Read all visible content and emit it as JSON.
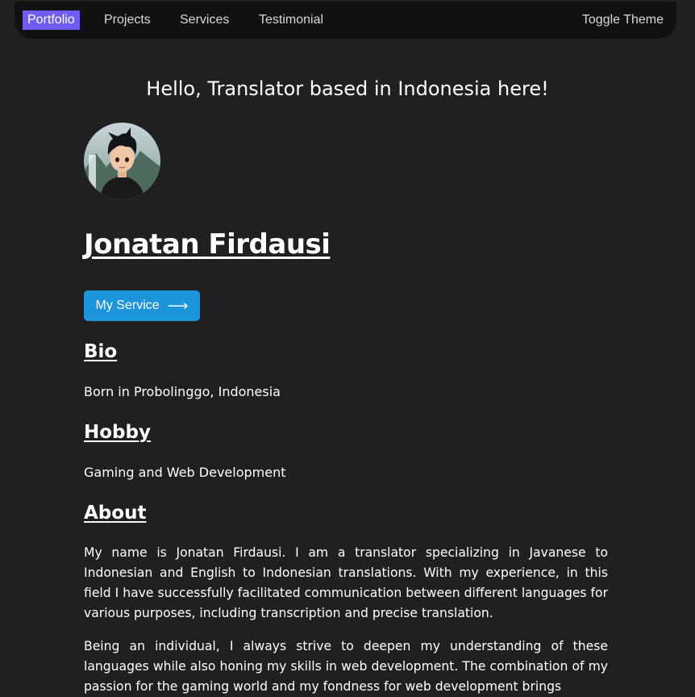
{
  "nav": {
    "items": [
      {
        "label": "Portfolio"
      },
      {
        "label": "Projects"
      },
      {
        "label": "Services"
      },
      {
        "label": "Testimonial"
      }
    ],
    "toggle_label": "Toggle Theme",
    "active_color": "#6f5cf6"
  },
  "hero": {
    "greeting": "Hello, Translator based in Indonesia here!",
    "name": "Jonatan Firdausi",
    "button_label": "My Service",
    "button_icon": "arrow-right-icon",
    "button_color": "#1d95dd"
  },
  "sections": {
    "bio": {
      "title": "Bio",
      "text": "Born in Probolinggo, Indonesia"
    },
    "hobby": {
      "title": "Hobby",
      "text": "Gaming and Web Development"
    },
    "about": {
      "title": "About",
      "paragraphs": [
        "My name is Jonatan Firdausi. I am a translator specializing in Javanese to Indonesian and English to Indonesian translations. With my experience, in this field I have successfully facilitated communication between different languages for various purposes, including transcription and precise translation.",
        "Being an individual, I always strive to deepen my understanding of these languages while also honing my skills in web development. The combination of my passion for the gaming world and my fondness for web development brings"
      ]
    }
  },
  "theme": {
    "background": "#202023",
    "navbar": "#111111",
    "text": "#ffffff"
  }
}
